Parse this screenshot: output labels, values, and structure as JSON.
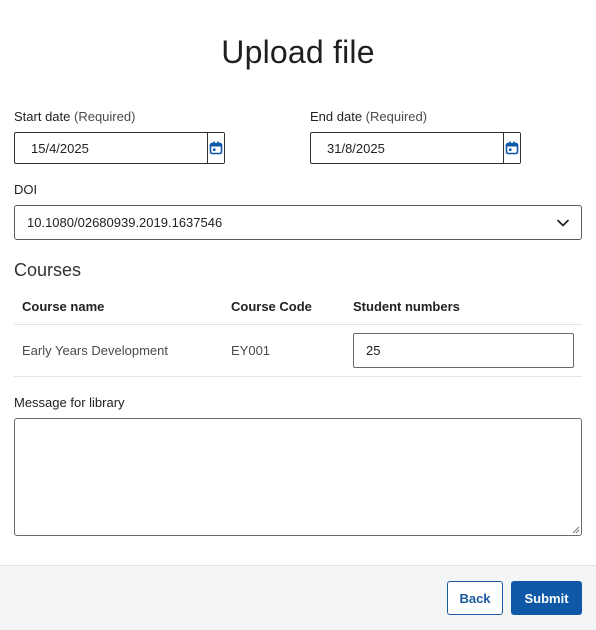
{
  "page": {
    "title": "Upload file"
  },
  "start_date": {
    "label": "Start date",
    "required": "(Required)",
    "value": "15/4/2025",
    "icon": "calendar-icon"
  },
  "end_date": {
    "label": "End date",
    "required": "(Required)",
    "value": "31/8/2025",
    "icon": "calendar-icon"
  },
  "doi": {
    "label": "DOI",
    "value": "10.1080/02680939.2019.1637546",
    "icon": "chevron-down-icon"
  },
  "courses": {
    "title": "Courses",
    "headers": [
      "Course name",
      "Course Code",
      "Student numbers"
    ],
    "rows": [
      {
        "name": "Early Years Development",
        "code": "EY001",
        "students": "25"
      }
    ]
  },
  "message": {
    "label": "Message for library",
    "value": ""
  },
  "footer": {
    "back_label": "Back",
    "submit_label": "Submit"
  },
  "colors": {
    "primary": "#0f58a8",
    "footer_bg": "#f4f5f7"
  }
}
